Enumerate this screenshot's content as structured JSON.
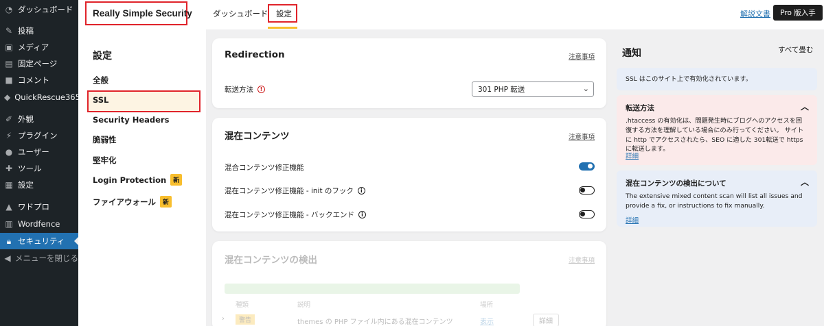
{
  "wp_menu": {
    "items": [
      {
        "label": "ダッシュボード",
        "icon": "gauge-icon"
      },
      {
        "label": "投稿",
        "icon": "pin-icon"
      },
      {
        "label": "メディア",
        "icon": "media-icon"
      },
      {
        "label": "固定ページ",
        "icon": "page-icon"
      },
      {
        "label": "コメント",
        "icon": "comment-icon"
      },
      {
        "label": "QuickRescue365",
        "icon": "shield-icon"
      },
      {
        "label": "外観",
        "icon": "brush-icon"
      },
      {
        "label": "プラグイン",
        "icon": "plug-icon"
      },
      {
        "label": "ユーザー",
        "icon": "user-icon"
      },
      {
        "label": "ツール",
        "icon": "wrench-icon"
      },
      {
        "label": "設定",
        "icon": "settings-icon"
      },
      {
        "label": "ワドプロ",
        "icon": "cap-icon"
      },
      {
        "label": "Wordfence",
        "icon": "wordfence-icon"
      },
      {
        "label": "セキュリティ",
        "icon": "lock-icon"
      },
      {
        "label": "メニューを閉じる",
        "icon": "collapse-icon"
      }
    ]
  },
  "header": {
    "brand": "Really Simple Security",
    "tabs": [
      "ダッシュボード",
      "設定"
    ],
    "help_link": "解説文書",
    "pro_button": "Pro 版入手"
  },
  "settings_menu": {
    "title": "設定",
    "items": [
      {
        "label": "全般"
      },
      {
        "label": "SSL"
      },
      {
        "label": "Security Headers"
      },
      {
        "label": "脆弱性"
      },
      {
        "label": "堅牢化"
      },
      {
        "label": "Login Protection",
        "badge": "新"
      },
      {
        "label": "ファイアウォール",
        "badge": "新"
      }
    ]
  },
  "redirection_card": {
    "title": "Redirection",
    "help": "注意事項",
    "field_label": "転送方法",
    "select_value": "301 PHP 転送"
  },
  "mixed_content_card": {
    "title": "混在コンテンツ",
    "help": "注意事項",
    "rows": [
      {
        "label": "混合コンテンツ修正機能",
        "enabled": true
      },
      {
        "label": "混在コンテンツ修正機能 - init のフック",
        "enabled": false
      },
      {
        "label": "混在コンテンツ修正機能 - バックエンド",
        "enabled": false
      }
    ]
  },
  "scan_card": {
    "title": "混在コンテンツの検出",
    "help": "注意事項",
    "columns": [
      "種類",
      "説明",
      "場所"
    ],
    "row": {
      "type": "警告",
      "description": "themes の PHP ファイル内にある混在コンテンツ",
      "location": "表示",
      "action": "詳細"
    }
  },
  "notifications": {
    "title": "通知",
    "collapse_all": "すべて畳む",
    "info": "SSL はこのサイト上で有効化されています。",
    "cards": [
      {
        "title": "転送方法",
        "body": ".htaccess の有効化は、問題発生時にブログへのアクセスを回復する方法を理解している場合にのみ行ってください。 サイトに http でアクセスされたら、SEO に適した 301転送で https に転送します。",
        "more": "詳細",
        "bg": "#fbeaea"
      },
      {
        "title": "混在コンテンツの検出について",
        "body": "The extensive mixed content scan will list all issues and provide a fix, or instructions to fix manually.",
        "more": "詳細",
        "bg": "#e8eef8"
      }
    ]
  },
  "colors": {
    "accent": "#2271b1",
    "highlight": "#e0232a",
    "badge": "#f8be2e"
  }
}
